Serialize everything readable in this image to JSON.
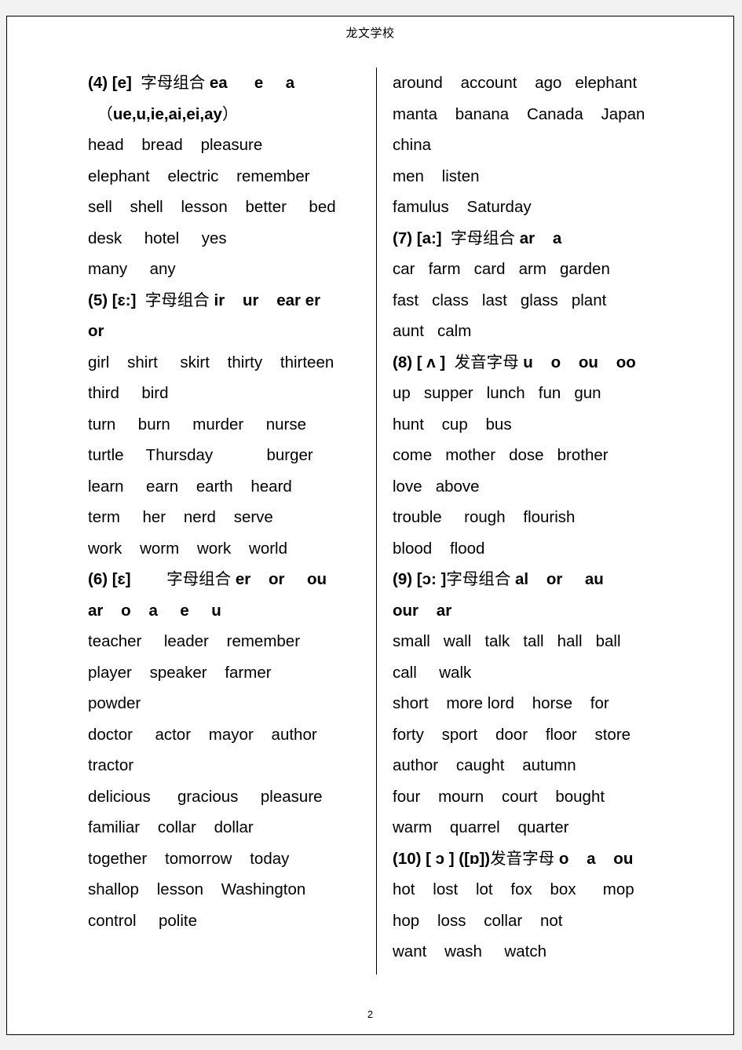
{
  "document": {
    "header_title": "龙文学校",
    "page_number": "2"
  },
  "left_column": {
    "blocks": [
      {
        "type": "heading",
        "text": "(4) [e]  字母组合 ea      e     a"
      },
      {
        "type": "heading",
        "text": "  （ue,u,ie,ai,ei,ay）"
      },
      {
        "type": "words",
        "text": "head    bread    pleasure"
      },
      {
        "type": "words",
        "text": "elephant    electric    remember"
      },
      {
        "type": "words",
        "text": "sell    shell    lesson    better     bed"
      },
      {
        "type": "words",
        "text": "desk     hotel     yes"
      },
      {
        "type": "words",
        "text": "many     any"
      },
      {
        "type": "heading",
        "text": "(5) [ɛ:]  字母组合 ir    ur    ear er"
      },
      {
        "type": "heading",
        "text": "or"
      },
      {
        "type": "words",
        "text": "girl    shirt     skirt    thirty    thirteen"
      },
      {
        "type": "words",
        "text": "third     bird"
      },
      {
        "type": "words",
        "text": "turn     burn     murder     nurse"
      },
      {
        "type": "words",
        "text": "turtle     Thursday            burger"
      },
      {
        "type": "words",
        "text": "learn     earn    earth    heard"
      },
      {
        "type": "words",
        "text": "term     her    nerd    serve"
      },
      {
        "type": "words",
        "text": "work    worm    work    world"
      },
      {
        "type": "heading",
        "text": "(6) [ɛ]        字母组合 er    or     ou"
      },
      {
        "type": "heading",
        "text": "ar    o    a     e     u"
      },
      {
        "type": "words",
        "text": "teacher     leader    remember"
      },
      {
        "type": "words",
        "text": "player    speaker    farmer"
      },
      {
        "type": "words",
        "text": "powder"
      },
      {
        "type": "words",
        "text": "doctor     actor    mayor    author"
      },
      {
        "type": "words",
        "text": "tractor"
      },
      {
        "type": "words",
        "text": "delicious      gracious     pleasure"
      },
      {
        "type": "words",
        "text": "familiar    collar    dollar"
      },
      {
        "type": "words",
        "text": "together    tomorrow    today"
      },
      {
        "type": "words",
        "text": "shallop    lesson    Washington"
      },
      {
        "type": "words",
        "text": "control     polite"
      }
    ]
  },
  "right_column": {
    "blocks": [
      {
        "type": "words",
        "text": "around    account    ago   elephant"
      },
      {
        "type": "words",
        "text": "manta    banana    Canada    Japan"
      },
      {
        "type": "words",
        "text": "china"
      },
      {
        "type": "words",
        "text": "men    listen"
      },
      {
        "type": "words",
        "text": "famulus    Saturday"
      },
      {
        "type": "heading",
        "text": "(7) [a:]  字母组合 ar    a"
      },
      {
        "type": "words",
        "text": "car   farm   card   arm   garden"
      },
      {
        "type": "words",
        "text": "fast   class   last   glass   plant"
      },
      {
        "type": "words",
        "text": "aunt   calm"
      },
      {
        "type": "heading",
        "text": "(8) [ ʌ ]  发音字母 u    o    ou    oo"
      },
      {
        "type": "words",
        "text": "up   supper   lunch   fun   gun"
      },
      {
        "type": "words",
        "text": "hunt    cup    bus"
      },
      {
        "type": "words",
        "text": "come   mother   dose   brother"
      },
      {
        "type": "words",
        "text": "love   above"
      },
      {
        "type": "words",
        "text": "trouble     rough    flourish"
      },
      {
        "type": "words",
        "text": "blood    flood"
      },
      {
        "type": "heading",
        "text": "(9) [ɔ: ]字母组合 al    or     au"
      },
      {
        "type": "heading",
        "text": "our    ar"
      },
      {
        "type": "words",
        "text": "small   wall   talk   tall   hall   ball"
      },
      {
        "type": "words",
        "text": "call     walk"
      },
      {
        "type": "words",
        "text": "short    more lord    horse    for"
      },
      {
        "type": "words",
        "text": "forty    sport    door    floor    store"
      },
      {
        "type": "words",
        "text": "author    caught    autumn"
      },
      {
        "type": "words",
        "text": "four    mourn    court    bought"
      },
      {
        "type": "words",
        "text": "warm    quarrel    quarter"
      },
      {
        "type": "heading",
        "text": "(10) [ ɔ ] ([ɒ])发音字母 o    a    ou"
      },
      {
        "type": "words",
        "text": "hot    lost    lot    fox    box      mop"
      },
      {
        "type": "words",
        "text": "hop    loss    collar    not"
      },
      {
        "type": "words",
        "text": "want    wash     watch"
      }
    ]
  }
}
